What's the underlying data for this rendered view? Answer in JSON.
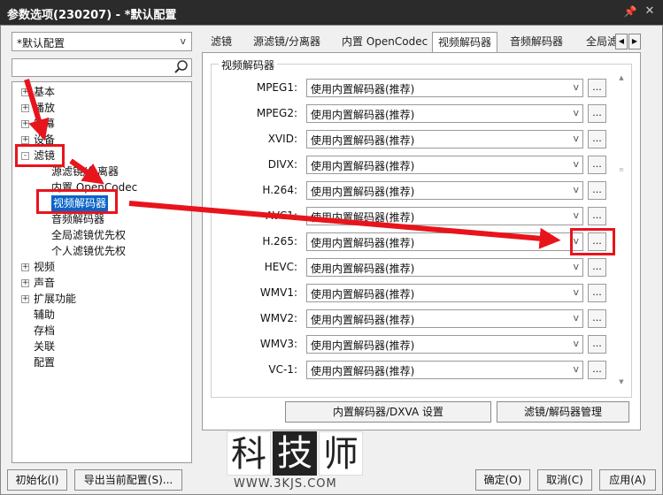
{
  "window": {
    "title": "参数选项(230207) - *默认配置",
    "pin_icon": "pin-icon",
    "close_icon": "close-icon"
  },
  "left": {
    "preset_value": "*默认配置",
    "search_placeholder": "",
    "tree": [
      {
        "label": "基本",
        "expander": "+"
      },
      {
        "label": "播放",
        "expander": "+"
      },
      {
        "label": "字幕",
        "expander": "+"
      },
      {
        "label": "设备",
        "expander": "+"
      },
      {
        "label": "滤镜",
        "expander": "-"
      },
      {
        "label": "源滤镜/分离器"
      },
      {
        "label": "内置 OpenCodec"
      },
      {
        "label": "视频解码器",
        "selected": true
      },
      {
        "label": "音频解码器"
      },
      {
        "label": "全局滤镜优先权"
      },
      {
        "label": "个人滤镜优先权"
      },
      {
        "label": "视频",
        "expander": "+"
      },
      {
        "label": "声音",
        "expander": "+"
      },
      {
        "label": "扩展功能",
        "expander": "+"
      },
      {
        "label": "辅助"
      },
      {
        "label": "存档"
      },
      {
        "label": "关联"
      },
      {
        "label": "配置"
      }
    ]
  },
  "tabs": [
    {
      "label": "滤镜"
    },
    {
      "label": "源滤镜/分离器"
    },
    {
      "label": "内置 OpenCodec"
    },
    {
      "label": "视频解码器",
      "active": true
    },
    {
      "label": "音频解码器"
    },
    {
      "label": "全局滤"
    }
  ],
  "panel": {
    "group_title": "视频解码器",
    "rows": [
      {
        "label": "MPEG1:",
        "value": "使用内置解码器(推荐)"
      },
      {
        "label": "MPEG2:",
        "value": "使用内置解码器(推荐)"
      },
      {
        "label": "XVID:",
        "value": "使用内置解码器(推荐)"
      },
      {
        "label": "DIVX:",
        "value": "使用内置解码器(推荐)"
      },
      {
        "label": "H.264:",
        "value": "使用内置解码器(推荐)"
      },
      {
        "label": "AVC1:",
        "value": "使用内置解码器(推荐)"
      },
      {
        "label": "H.265:",
        "value": "使用内置解码器(推荐)"
      },
      {
        "label": "HEVC:",
        "value": "使用内置解码器(推荐)"
      },
      {
        "label": "WMV1:",
        "value": "使用内置解码器(推荐)"
      },
      {
        "label": "WMV2:",
        "value": "使用内置解码器(推荐)"
      },
      {
        "label": "WMV3:",
        "value": "使用内置解码器(推荐)"
      },
      {
        "label": "VC-1:",
        "value": "使用内置解码器(推荐)"
      }
    ],
    "dots_label": "...",
    "dxva_button": "内置解码器/DXVA 设置",
    "manage_button": "滤镜/解码器管理"
  },
  "bottom": {
    "init_button": "初始化(I)",
    "export_button": "导出当前配置(S)...",
    "ok_button": "确定(O)",
    "cancel_button": "取消(C)",
    "apply_button": "应用(A)"
  },
  "watermark": {
    "chars": [
      "科",
      "技",
      "师"
    ],
    "url": "WWW.3KJS.COM"
  },
  "colors": {
    "annotation": "#e8141c",
    "selection": "#0a64c8",
    "titlebar": "#2b2b2b"
  }
}
